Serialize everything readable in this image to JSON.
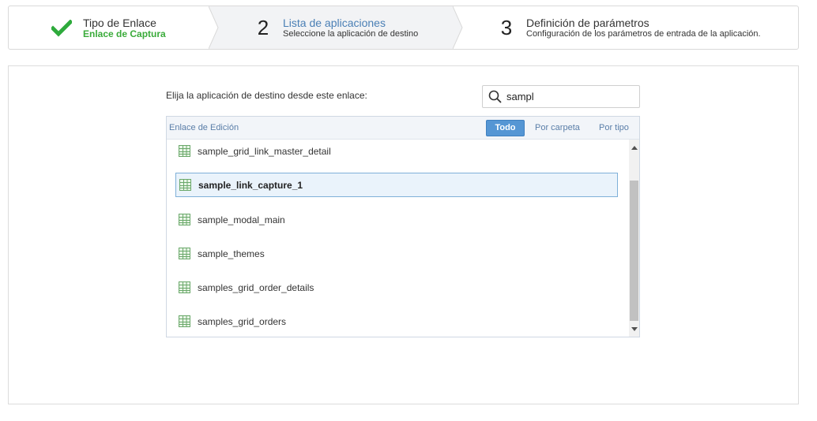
{
  "wizard": {
    "step1": {
      "title": "Tipo de Enlace",
      "subtitle": "Enlace de Captura"
    },
    "step2": {
      "number": "2",
      "title": "Lista de aplicaciones",
      "subtitle": "Seleccione la aplicación de destino"
    },
    "step3": {
      "number": "3",
      "title": "Definición de parámetros",
      "subtitle": "Configuración de los parámetros de entrada de la aplicación."
    }
  },
  "main": {
    "prompt": "Elija la aplicación de destino desde este enlace:",
    "search": {
      "value": "sampl"
    },
    "list": {
      "header_label": "Enlace de Edición",
      "filters": {
        "all": "Todo",
        "by_folder": "Por carpeta",
        "by_type": "Por tipo"
      },
      "items": [
        {
          "label": "sample_grid_link_master_detail"
        },
        {
          "label": "sample_link_capture_1",
          "selected": true
        },
        {
          "label": "sample_modal_main"
        },
        {
          "label": "sample_themes"
        },
        {
          "label": "samples_grid_order_details"
        },
        {
          "label": "samples_grid_orders"
        }
      ]
    }
  },
  "colors": {
    "accent_blue": "#5596d4",
    "check_green": "#3aab3a",
    "link_blue": "#5a7ea8"
  },
  "icons": {
    "step1": "checkmark-icon",
    "search": "search-icon",
    "item": "grid-table-icon"
  }
}
